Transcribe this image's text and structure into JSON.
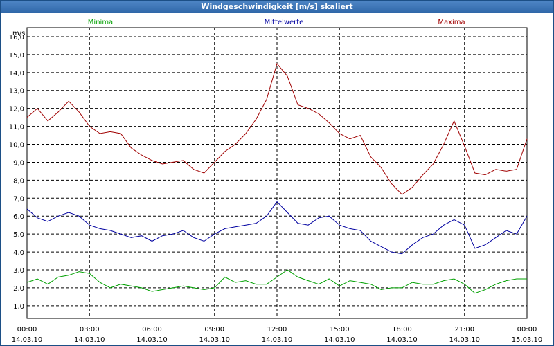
{
  "window": {
    "title": "Windgeschwindigkeit [m/s] skaliert"
  },
  "chart_data": {
    "type": "line",
    "title": "Windgeschwindigkeit [m/s] skaliert",
    "ylabel": "m/s",
    "ylim": [
      0.3,
      16.5
    ],
    "xlim": [
      0,
      24
    ],
    "grid": true,
    "legend_placement": "top",
    "y_ticks": [
      "1,0",
      "2,0",
      "3,0",
      "4,0",
      "5,0",
      "6,0",
      "7,0",
      "8,0",
      "9,0",
      "10,0",
      "11,0",
      "12,0",
      "13,0",
      "14,0",
      "15,0",
      "16,0"
    ],
    "x_ticks": [
      {
        "time": "00:00",
        "date": "14.03.10"
      },
      {
        "time": "03:00",
        "date": "14.03.10"
      },
      {
        "time": "06:00",
        "date": "14.03.10"
      },
      {
        "time": "09:00",
        "date": "14.03.10"
      },
      {
        "time": "12:00",
        "date": "14.03.10"
      },
      {
        "time": "15:00",
        "date": "14.03.10"
      },
      {
        "time": "18:00",
        "date": "14.03.10"
      },
      {
        "time": "21:00",
        "date": "14.03.10"
      },
      {
        "time": "00:00",
        "date": "15.03.10"
      }
    ],
    "x_hours": [
      0,
      0.5,
      1,
      1.5,
      2,
      2.5,
      3,
      3.5,
      4,
      4.5,
      5,
      5.5,
      6,
      6.5,
      7,
      7.5,
      8,
      8.5,
      9,
      9.5,
      10,
      10.5,
      11,
      11.5,
      12,
      12.5,
      13,
      13.5,
      14,
      14.5,
      15,
      15.5,
      16,
      16.5,
      17,
      17.5,
      18,
      18.5,
      19,
      19.5,
      20,
      20.5,
      21,
      21.5,
      22,
      22.5,
      23,
      23.5,
      24
    ],
    "series": [
      {
        "name": "Minima",
        "color": "#00a000",
        "values": [
          2.3,
          2.5,
          2.2,
          2.6,
          2.7,
          2.9,
          2.8,
          2.3,
          2.0,
          2.2,
          2.1,
          2.0,
          1.8,
          1.9,
          2.0,
          2.1,
          2.0,
          1.9,
          2.0,
          2.6,
          2.3,
          2.4,
          2.2,
          2.2,
          2.6,
          3.0,
          2.6,
          2.4,
          2.2,
          2.5,
          2.1,
          2.4,
          2.3,
          2.2,
          1.9,
          2.0,
          2.0,
          2.3,
          2.2,
          2.2,
          2.4,
          2.5,
          2.2,
          1.7,
          1.9,
          2.2,
          2.4,
          2.5,
          2.5
        ]
      },
      {
        "name": "Mittelwerte",
        "color": "#0000a0",
        "values": [
          6.4,
          5.9,
          5.7,
          6.0,
          6.2,
          6.0,
          5.5,
          5.3,
          5.2,
          5.0,
          4.8,
          4.9,
          4.6,
          4.9,
          5.0,
          5.2,
          4.8,
          4.6,
          5.0,
          5.3,
          5.4,
          5.5,
          5.6,
          6.0,
          6.8,
          6.2,
          5.6,
          5.5,
          5.9,
          6.0,
          5.5,
          5.3,
          5.2,
          4.6,
          4.3,
          4.0,
          3.9,
          4.4,
          4.8,
          5.0,
          5.5,
          5.8,
          5.5,
          4.2,
          4.4,
          4.8,
          5.2,
          5.0,
          6.0
        ]
      },
      {
        "name": "Maxima",
        "color": "#a00000",
        "values": [
          11.5,
          12.0,
          11.3,
          11.8,
          12.4,
          11.8,
          11.0,
          10.6,
          10.7,
          10.6,
          9.8,
          9.4,
          9.1,
          8.9,
          9.0,
          9.1,
          8.6,
          8.4,
          9.0,
          9.6,
          10.0,
          10.6,
          11.4,
          12.5,
          14.5,
          13.8,
          12.2,
          12.0,
          11.7,
          11.2,
          10.6,
          10.3,
          10.5,
          9.3,
          8.7,
          7.8,
          7.2,
          7.6,
          8.3,
          8.9,
          10.0,
          11.3,
          9.9,
          8.4,
          8.3,
          8.6,
          8.5,
          8.6,
          10.3
        ]
      }
    ]
  }
}
